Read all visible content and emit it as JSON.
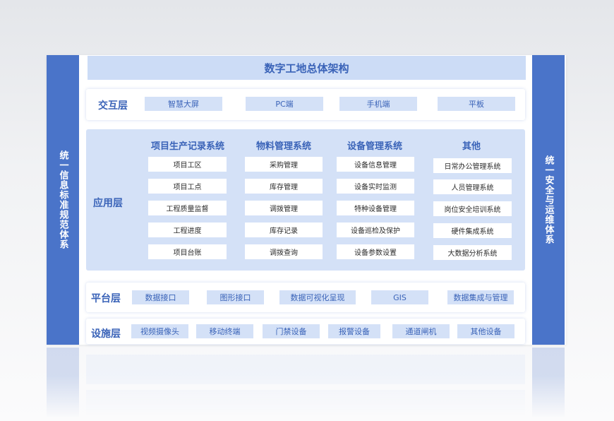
{
  "title": "数字工地总体架构",
  "left_banner": "统一信息标准规范体系",
  "right_banner": "统一安全与运维体系",
  "interaction_layer": {
    "label": "交互层",
    "items": [
      "智慧大屏",
      "PC端",
      "手机端",
      "平板"
    ]
  },
  "application_layer": {
    "label": "应用层",
    "systems": [
      {
        "name": "项目生产记录系统",
        "items": [
          "项目工区",
          "项目工点",
          "工程质量监督",
          "工程进度",
          "项目台账"
        ]
      },
      {
        "name": "物料管理系统",
        "items": [
          "采购管理",
          "库存管理",
          "调拨管理",
          "库存记录",
          "调拨查询"
        ]
      },
      {
        "name": "设备管理系统",
        "items": [
          "设备信息管理",
          "设备实时监测",
          "特种设备管理",
          "设备巡检及保护",
          "设备参数设置"
        ]
      },
      {
        "name": "其他",
        "items": [
          "日常办公管理系统",
          "人员管理系统",
          "岗位安全培训系统",
          "硬件集成系统",
          "大数据分析系统"
        ]
      }
    ]
  },
  "platform_layer": {
    "label": "平台层",
    "items": [
      "数据接口",
      "图形接口",
      "数据可视化呈现",
      "GIS",
      "数据集成与管理"
    ]
  },
  "infrastructure_layer": {
    "label": "设施层",
    "items": [
      "视频摄像头",
      "移动终端",
      "门禁设备",
      "报警设备",
      "通道闸机",
      "其他设备"
    ]
  },
  "colors": {
    "accent": "#4a74c9",
    "light": "#d4e1f7",
    "title_bg": "#ccdcf6",
    "text": "#3a63b8"
  }
}
